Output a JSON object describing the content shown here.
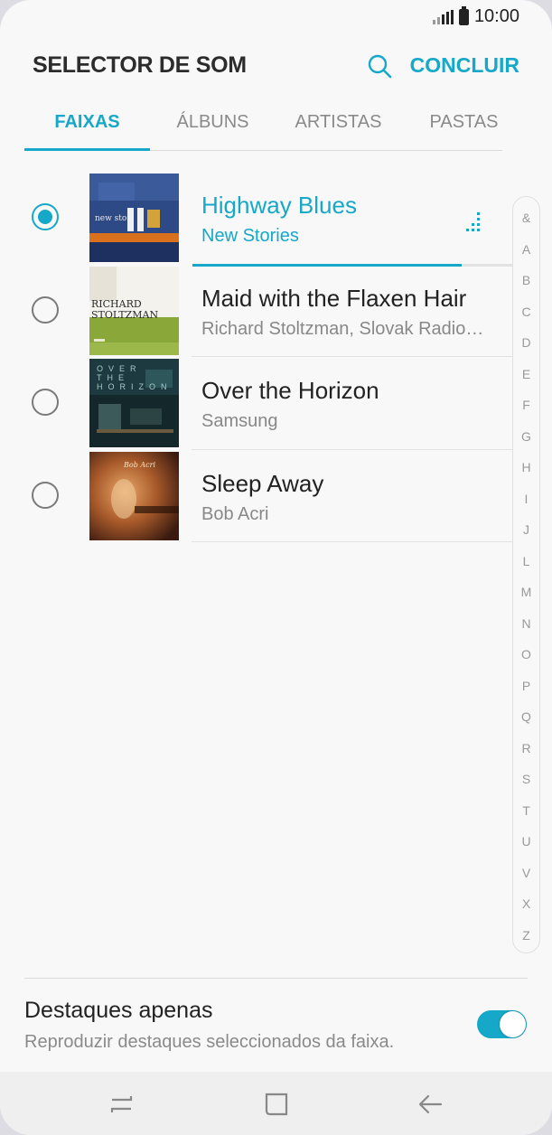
{
  "status_bar": {
    "time": "10:00",
    "signal_icon": "signal-icon",
    "battery_icon": "battery-icon"
  },
  "header": {
    "title": "SELECTOR DE SOM",
    "search_icon": "search-icon",
    "done_label": "CONCLUIR"
  },
  "tabs": [
    {
      "label": "FAIXAS",
      "active": true
    },
    {
      "label": "ÁLBUNS",
      "active": false
    },
    {
      "label": "ARTISTAS",
      "active": false
    },
    {
      "label": "PASTAS",
      "active": false
    }
  ],
  "tracks": [
    {
      "title": "Highway Blues",
      "artist": "New Stories",
      "selected": true,
      "playback_progress": 0.84,
      "album_art_text": "new sto"
    },
    {
      "title": "Maid with the Flaxen Hair",
      "artist": "Richard Stoltzman, Slovak Radio Symphony Orchestra",
      "selected": false,
      "album_art_text": "RICHARD STOLTZMAN"
    },
    {
      "title": "Over the Horizon",
      "artist": "Samsung",
      "selected": false,
      "album_art_text": "OVER THE HORIZON"
    },
    {
      "title": "Sleep Away",
      "artist": "Bob Acri",
      "selected": false,
      "album_art_text": "Bob Acri"
    }
  ],
  "index_letters": [
    "&",
    "A",
    "B",
    "C",
    "D",
    "E",
    "F",
    "G",
    "H",
    "I",
    "J",
    "L",
    "M",
    "N",
    "O",
    "P",
    "Q",
    "R",
    "S",
    "T",
    "U",
    "V",
    "X",
    "Z"
  ],
  "highlights": {
    "title": "Destaques apenas",
    "description": "Reproduzir destaques seleccionados da faixa.",
    "enabled": true
  },
  "nav_bar": {
    "recents_icon": "recents-icon",
    "home_icon": "home-icon",
    "back_icon": "back-icon"
  },
  "colors": {
    "accent": "#16a8c8",
    "background": "#f8f8f8",
    "text": "#222222"
  }
}
